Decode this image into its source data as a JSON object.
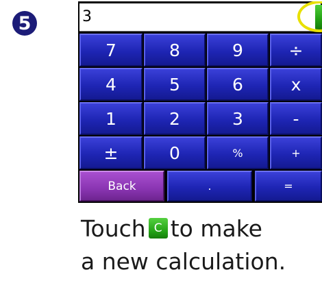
{
  "step": {
    "number": "5"
  },
  "calculator": {
    "display_value": "3",
    "clear_label": "C",
    "keys": [
      [
        "7",
        "8",
        "9",
        "÷"
      ],
      [
        "4",
        "5",
        "6",
        "x"
      ],
      [
        "1",
        "2",
        "3",
        "-"
      ],
      [
        "±",
        "0",
        "%",
        "+"
      ]
    ],
    "bottom_row": {
      "back": "Back",
      "decimal": ".",
      "equals": "="
    }
  },
  "caption": {
    "before_icon": "Touch",
    "icon_label": "C",
    "after_icon": "to make",
    "line2": "a new calculation."
  },
  "colors": {
    "key_blue": "#1e25b4",
    "back_purple": "#8a35b2",
    "clear_green": "#22a012",
    "highlight_yellow": "#e8e000",
    "badge_navy": "#1c1c78"
  }
}
